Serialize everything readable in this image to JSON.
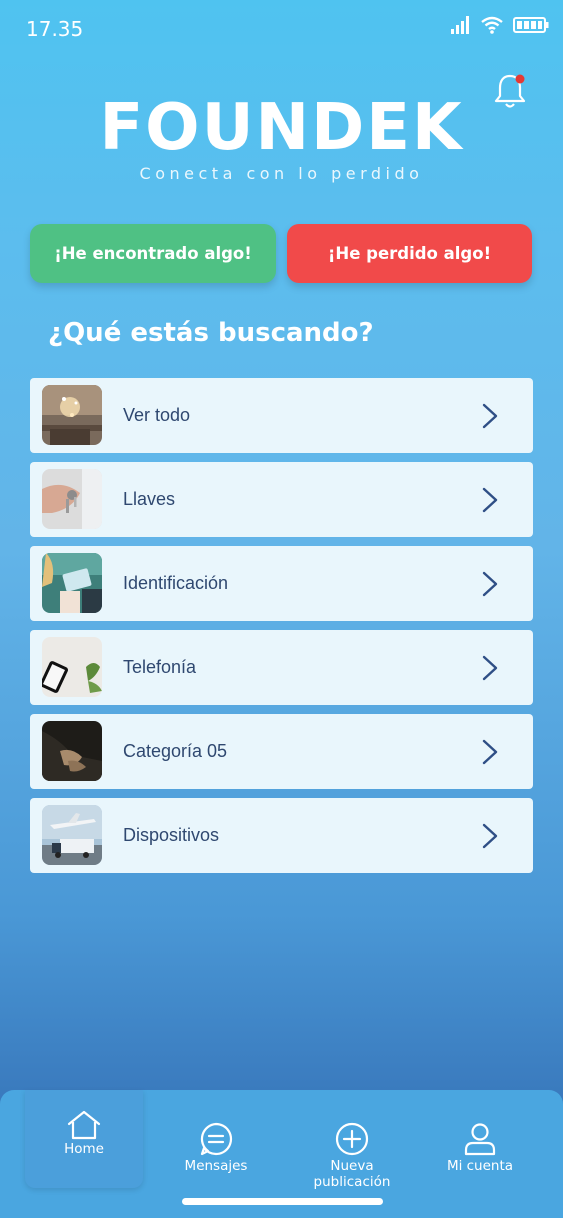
{
  "status_bar": {
    "time": "17.35"
  },
  "header": {
    "logo_title": "FOUNDEK",
    "tagline": "Conecta con lo perdido",
    "notification_dot_color": "#e53935"
  },
  "actions": {
    "found_label": "¡He encontrado algo!",
    "lost_label": "¡He perdido algo!",
    "found_color": "#4fc184",
    "lost_color": "#f14a4a"
  },
  "section_title": "¿Qué estás buscando?",
  "categories": [
    {
      "label": "Ver todo",
      "icon": "sparkle-image"
    },
    {
      "label": "Llaves",
      "icon": "keys-image"
    },
    {
      "label": "Identificación",
      "icon": "id-card-image"
    },
    {
      "label": "Telefonía",
      "icon": "phone-image"
    },
    {
      "label": "Categoría 05",
      "icon": "hands-image"
    },
    {
      "label": "Dispositivos",
      "icon": "plane-truck-image"
    }
  ],
  "tab_bar": {
    "items": [
      {
        "label": "Home",
        "icon": "home-icon",
        "active": true
      },
      {
        "label": "Mensajes",
        "icon": "message-icon",
        "active": false
      },
      {
        "label": "Nueva publicación",
        "icon": "plus-circle-icon",
        "active": false
      },
      {
        "label": "Mi cuenta",
        "icon": "user-icon",
        "active": false
      }
    ]
  }
}
